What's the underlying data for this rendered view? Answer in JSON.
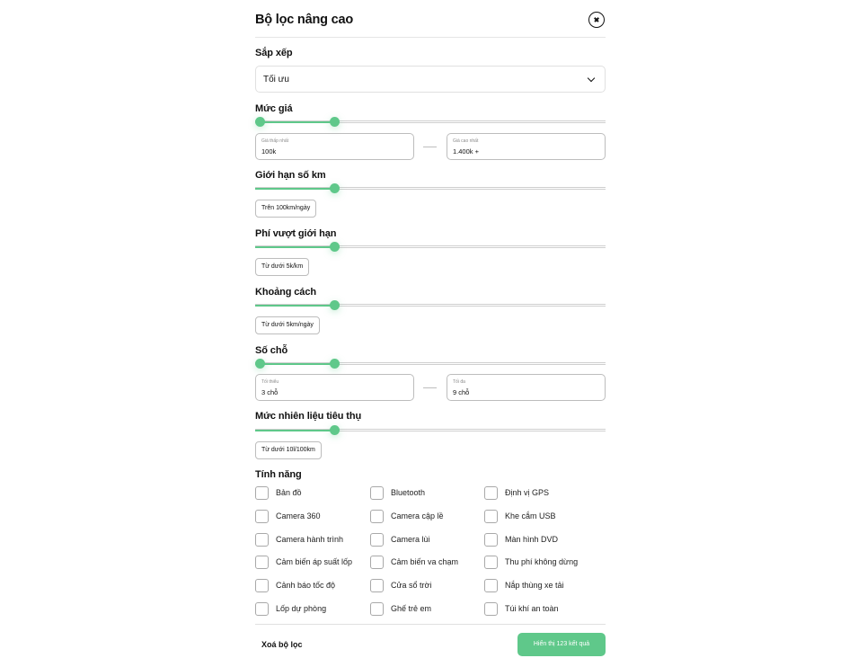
{
  "header": {
    "title": "Bộ lọc nâng cao"
  },
  "sort": {
    "title": "Sắp xếp",
    "selected": "Tối ưu"
  },
  "price": {
    "title": "Mức giá",
    "range": [
      0,
      0.22
    ],
    "min": {
      "label": "Giá thấp nhất",
      "value": "100k"
    },
    "max": {
      "label": "Giá cao nhất",
      "value": "1.400k +"
    }
  },
  "distance_limit": {
    "title": "Giới hạn số km",
    "level": 0.22,
    "chip": "Trên 100km/ngày"
  },
  "overage_fee": {
    "title": "Phí vượt giới hạn",
    "level": 0.22,
    "chip": "Từ dưới 5k/km"
  },
  "delivery_distance": {
    "title": "Khoảng cách",
    "level": 0.22,
    "chip": "Từ dưới 5km/ngày"
  },
  "seats": {
    "title": "Số chỗ",
    "range": [
      0,
      0.22
    ],
    "min": {
      "label": "Tối thiểu",
      "value": "3 chỗ"
    },
    "max": {
      "label": "Tối đa",
      "value": "9 chỗ"
    }
  },
  "fuel": {
    "title": "Mức nhiên liệu tiêu thụ",
    "level": 0.22,
    "chip": "Từ dưới 10l/100km"
  },
  "features": {
    "title": "Tính năng",
    "items": [
      "Bản đồ",
      "Bluetooth",
      "Định vị GPS",
      "Camera 360",
      "Camera cập lề",
      "Khe cắm USB",
      "Camera hành trình",
      "Camera lùi",
      "Màn hình DVD",
      "Cảm biến áp suất lốp",
      "Cảm biến va chạm",
      "Thu phí không dừng",
      "Cảnh báo tốc độ",
      "Cửa sổ trời",
      "Nắp thùng xe tải",
      "Lốp dự phòng",
      "Ghế trẻ em",
      "Túi khí an toàn"
    ],
    "checked": []
  },
  "footer": {
    "clear_label": "Xoá bộ lọc",
    "submit_label": "Hiển thị 123 kết quả"
  },
  "colors": {
    "accent": "#5fc88a",
    "border": "#bdbdbd",
    "text": "#111111"
  },
  "icons": {
    "close": "close-circle-icon",
    "dropdown": "chevron-down-icon"
  }
}
